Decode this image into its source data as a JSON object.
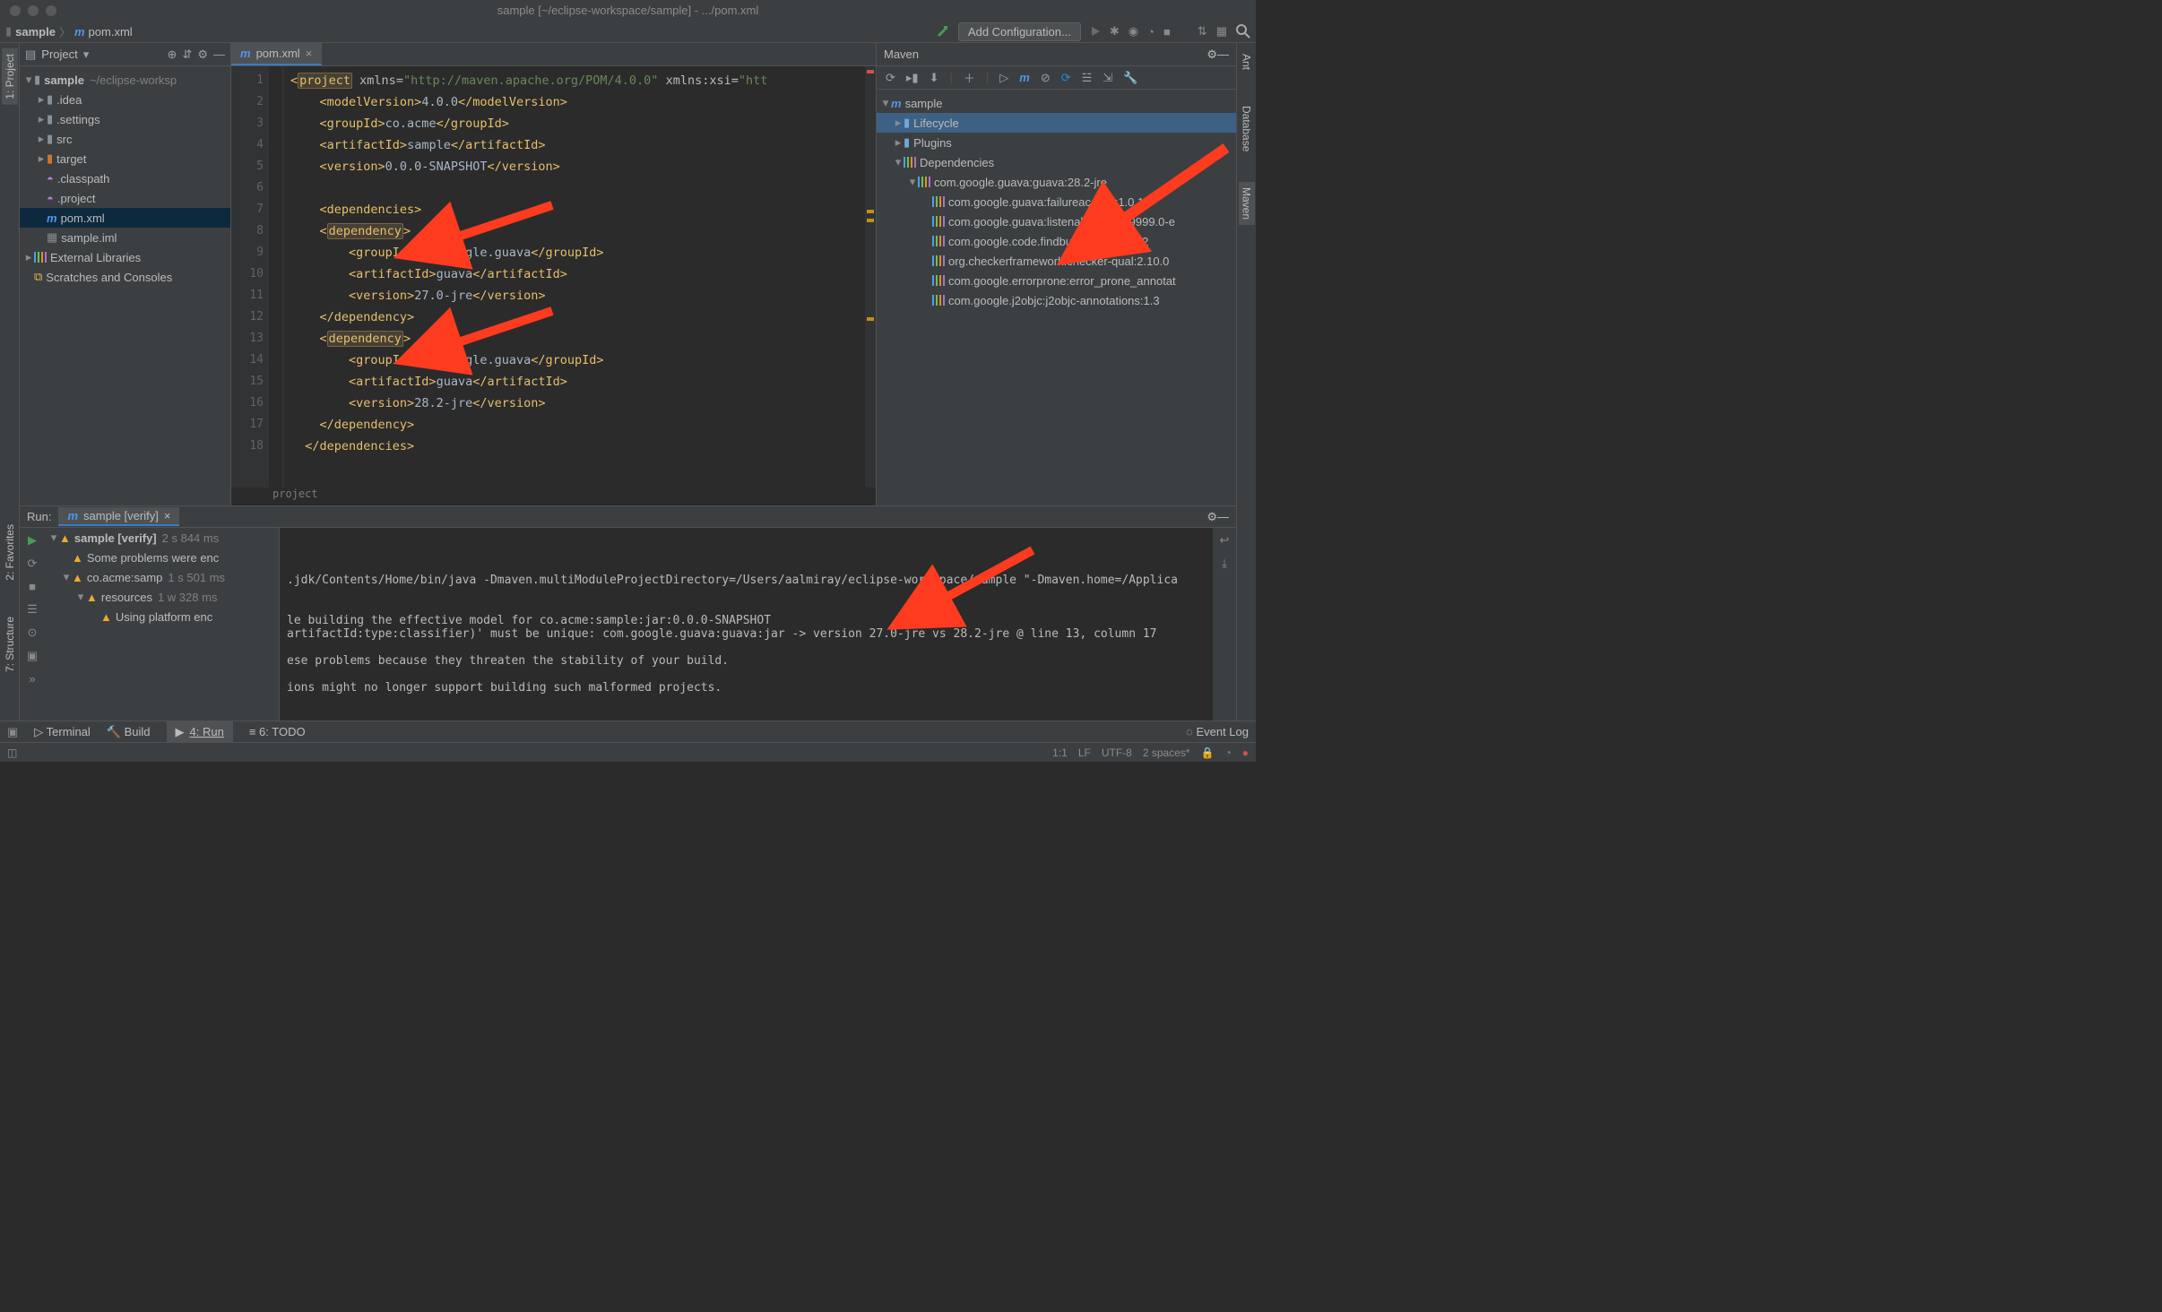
{
  "window": {
    "title": "sample [~/eclipse-workspace/sample] - .../pom.xml"
  },
  "breadcrumb": {
    "root": "sample",
    "file": "pom.xml"
  },
  "toolbar": {
    "add_config": "Add Configuration..."
  },
  "project": {
    "title": "Project",
    "root": "sample",
    "rootpath": "~/eclipse-worksp",
    "items": [
      {
        "name": ".idea",
        "kind": "folder"
      },
      {
        "name": ".settings",
        "kind": "folder"
      },
      {
        "name": "src",
        "kind": "folder"
      },
      {
        "name": "target",
        "kind": "folder_or"
      },
      {
        "name": ".classpath",
        "kind": "eclipse"
      },
      {
        "name": ".project",
        "kind": "eclipse"
      },
      {
        "name": "pom.xml",
        "kind": "maven",
        "selected": true
      },
      {
        "name": "sample.iml",
        "kind": "iml"
      }
    ],
    "external": "External Libraries",
    "scratches": "Scratches and Consoles"
  },
  "editor": {
    "tab": "pom.xml",
    "breadcrumb_local": "project",
    "lines": [
      {
        "n": 1,
        "pre": "",
        "h": [
          [
            "tag",
            "<"
          ],
          [
            "hl",
            "project"
          ],
          [
            "attr",
            " xmlns="
          ],
          [
            "str",
            "\"http://maven.apache.org/POM/4.0.0\""
          ],
          [
            "attr",
            " xmlns:xsi="
          ],
          [
            "str",
            "\"htt"
          ]
        ]
      },
      {
        "n": 2,
        "pre": "    ",
        "h": [
          [
            "tag",
            "<modelVersion>"
          ],
          [
            "txt",
            "4.0.0"
          ],
          [
            "tag",
            "</modelVersion>"
          ]
        ]
      },
      {
        "n": 3,
        "pre": "    ",
        "h": [
          [
            "tag",
            "<groupId>"
          ],
          [
            "txt",
            "co.acme"
          ],
          [
            "tag",
            "</groupId>"
          ]
        ]
      },
      {
        "n": 4,
        "pre": "    ",
        "h": [
          [
            "tag",
            "<artifactId>"
          ],
          [
            "txt",
            "sample"
          ],
          [
            "tag",
            "</artifactId>"
          ]
        ]
      },
      {
        "n": 5,
        "pre": "    ",
        "h": [
          [
            "tag",
            "<version>"
          ],
          [
            "txt",
            "0.0.0-SNAPSHOT"
          ],
          [
            "tag",
            "</version>"
          ]
        ]
      },
      {
        "n": 6,
        "pre": "",
        "h": []
      },
      {
        "n": 7,
        "pre": "    ",
        "h": [
          [
            "tag",
            "<dependencies>"
          ]
        ]
      },
      {
        "n": 8,
        "pre": "    ",
        "h": [
          [
            "tag",
            "<"
          ],
          [
            "hl",
            "dependency"
          ],
          [
            "tag",
            ">"
          ]
        ]
      },
      {
        "n": 9,
        "pre": "        ",
        "h": [
          [
            "tag",
            "<groupId>"
          ],
          [
            "txt",
            "com.google.guava"
          ],
          [
            "tag",
            "</groupId>"
          ]
        ]
      },
      {
        "n": 10,
        "pre": "        ",
        "h": [
          [
            "tag",
            "<artifactId>"
          ],
          [
            "txt",
            "guava"
          ],
          [
            "tag",
            "</artifactId>"
          ]
        ]
      },
      {
        "n": 11,
        "pre": "        ",
        "h": [
          [
            "tag",
            "<version>"
          ],
          [
            "txt",
            "27.0-jre"
          ],
          [
            "tag",
            "</version>"
          ]
        ]
      },
      {
        "n": 12,
        "pre": "    ",
        "h": [
          [
            "tag",
            "</dependency>"
          ]
        ]
      },
      {
        "n": 13,
        "pre": "    ",
        "h": [
          [
            "tag",
            "<"
          ],
          [
            "hl",
            "dependency"
          ],
          [
            "tag",
            ">"
          ]
        ]
      },
      {
        "n": 14,
        "pre": "        ",
        "h": [
          [
            "tag",
            "<groupId>"
          ],
          [
            "txt",
            "com.google.guava"
          ],
          [
            "tag",
            "</groupId>"
          ]
        ]
      },
      {
        "n": 15,
        "pre": "        ",
        "h": [
          [
            "tag",
            "<artifactId>"
          ],
          [
            "txt",
            "guava"
          ],
          [
            "tag",
            "</artifactId>"
          ]
        ]
      },
      {
        "n": 16,
        "pre": "        ",
        "h": [
          [
            "tag",
            "<version>"
          ],
          [
            "txt",
            "28.2-jre"
          ],
          [
            "tag",
            "</version>"
          ]
        ]
      },
      {
        "n": 17,
        "pre": "    ",
        "h": [
          [
            "tag",
            "</dependency>"
          ]
        ]
      },
      {
        "n": 18,
        "pre": "  ",
        "h": [
          [
            "tag",
            "</dependencies>"
          ]
        ]
      }
    ]
  },
  "maven": {
    "title": "Maven",
    "root": "sample",
    "lifecycle": "Lifecycle",
    "plugins": "Plugins",
    "deps_label": "Dependencies",
    "primary_dep": "com.google.guava:guava:28.2-jre",
    "deps": [
      "com.google.guava:failureaccess:1.0.1",
      "com.google.guava:listenablefuture:9999.0-e",
      "com.google.code.findbugs:jsr305:3.0.2",
      "org.checkerframework:checker-qual:2.10.0",
      "com.google.errorprone:error_prone_annotat",
      "com.google.j2objc:j2objc-annotations:1.3"
    ]
  },
  "run": {
    "label": "Run:",
    "config": "sample [verify]",
    "nodes": {
      "n0": {
        "label": "sample [verify]",
        "time": "2 s 844 ms"
      },
      "n1": {
        "label": "Some problems were enc"
      },
      "n2": {
        "label": "co.acme:samp",
        "time": "1 s 501 ms"
      },
      "n3": {
        "label": "resources",
        "time": "1 w 328 ms"
      },
      "n4": {
        "label": "Using platform enc"
      }
    },
    "out": [
      ".jdk/Contents/Home/bin/java -Dmaven.multiModuleProjectDirectory=/Users/aalmiray/eclipse-workspace/sample \"-Dmaven.home=/Applica",
      "",
      "",
      "le building the effective model for co.acme:sample:jar:0.0.0-SNAPSHOT",
      "artifactId:type:classifier)' must be unique: com.google.guava:guava:jar -> version 27.0-jre vs 28.2-jre @ line 13, column 17",
      "",
      "ese problems because they threaten the stability of your build.",
      "",
      "ions might no longer support building such malformed projects."
    ]
  },
  "bottom": {
    "terminal": "Terminal",
    "build": "Build",
    "run": "4: Run",
    "todo": "6: TODO",
    "eventlog": "Event Log"
  },
  "status": {
    "pos": "1:1",
    "le": "LF",
    "enc": "UTF-8",
    "indent": "2 spaces*"
  },
  "side": {
    "left": {
      "project": "1: Project",
      "fav": "2: Favorites",
      "struct": "7: Structure"
    },
    "right": {
      "ant": "Ant",
      "db": "Database",
      "maven": "Maven"
    }
  }
}
